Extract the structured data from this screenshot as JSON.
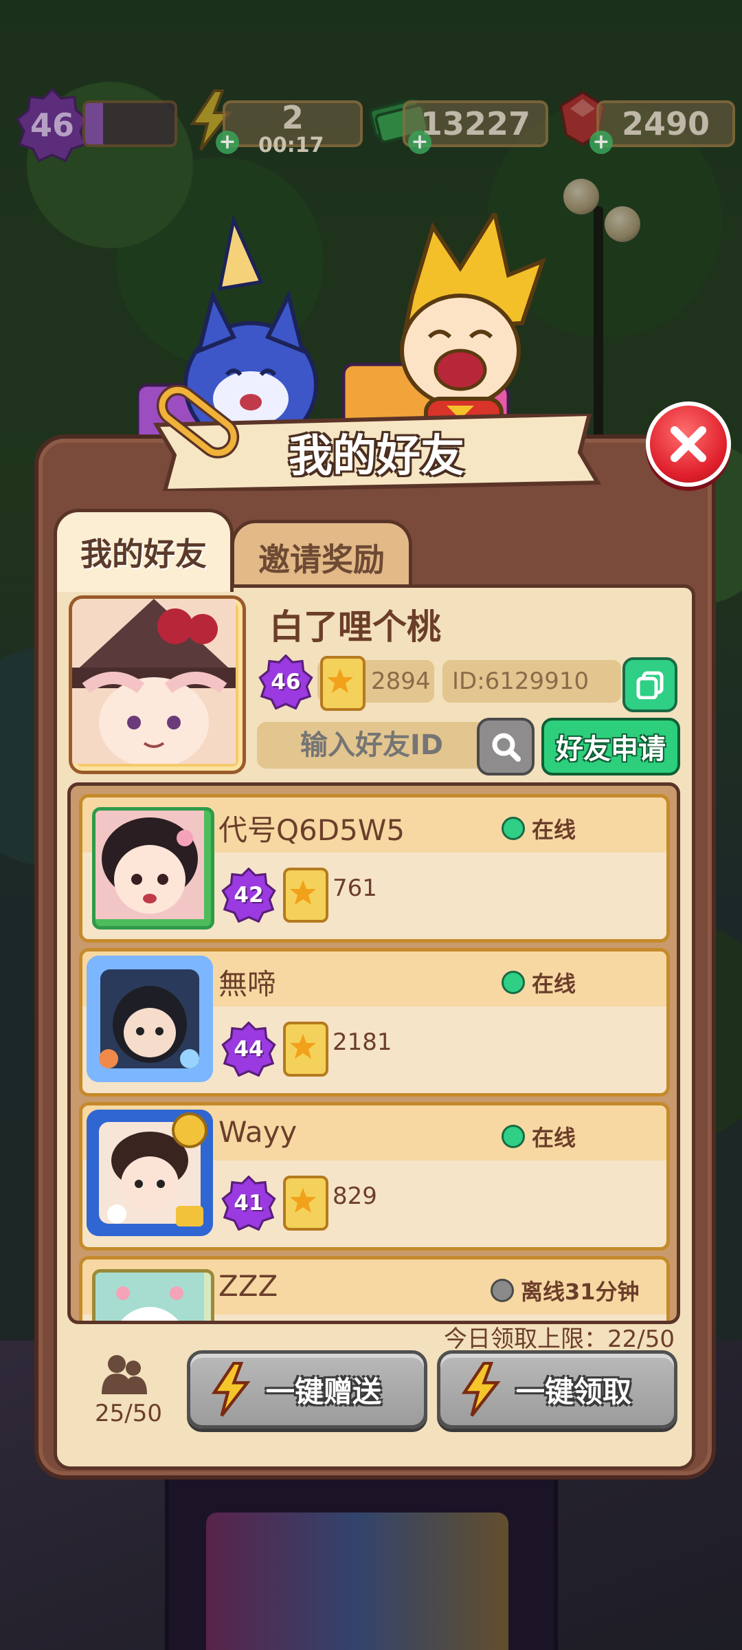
{
  "hud": {
    "level": "46",
    "xp_fraction": 0.2,
    "energy": "2",
    "energy_timer": "00:17",
    "cash": "13227",
    "gems": "2490",
    "plus": "+"
  },
  "panel": {
    "title": "我的好友",
    "tabs": [
      {
        "label": "我的好友",
        "active": true
      },
      {
        "label": "邀请奖励",
        "active": false
      }
    ],
    "profile": {
      "name": "白了哩个桃",
      "level": "46",
      "points": "2894",
      "id": "ID:6129910"
    },
    "search": {
      "placeholder": "输入好友ID",
      "request_label": "好友申请"
    },
    "friends": [
      {
        "name": "代号Q6D5W5",
        "status": "在线",
        "online": true,
        "level": "42",
        "points": "761"
      },
      {
        "name": "無啼",
        "status": "在线",
        "online": true,
        "level": "44",
        "points": "2181"
      },
      {
        "name": "Wayy",
        "status": "在线",
        "online": true,
        "level": "41",
        "points": "829"
      },
      {
        "name": "ZZZ",
        "status": "离线31分钟",
        "online": false,
        "level": "",
        "points": ""
      }
    ],
    "footer": {
      "daily_limit": "今日领取上限：22/50",
      "friend_count": "25/50",
      "send_all": "一键赠送",
      "claim_all": "一键领取"
    }
  },
  "colors": {
    "online": "#2fcf86",
    "offline": "#8a8a8a",
    "close": "#e0202c",
    "level_badge": "#8a2fd1"
  }
}
